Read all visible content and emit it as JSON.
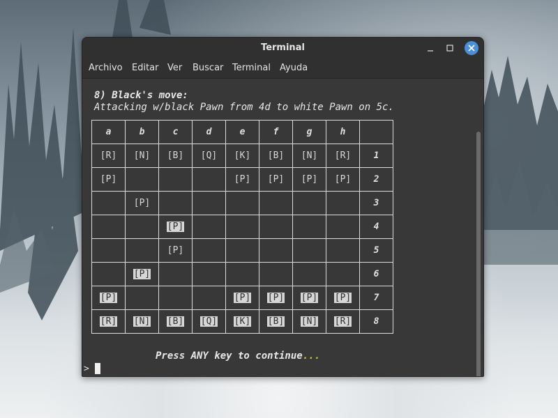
{
  "window": {
    "title": "Terminal"
  },
  "menu": [
    "Archivo",
    "Editar",
    "Ver",
    "Buscar",
    "Terminal",
    "Ayuda"
  ],
  "terminal": {
    "move_line": "8) Black's move:",
    "detail_line": "Attacking w/black Pawn from 4d to white Pawn on 5c.",
    "columns": [
      "a",
      "b",
      "c",
      "d",
      "e",
      "f",
      "g",
      "h",
      ""
    ],
    "rows": [
      {
        "cells": [
          "[R]",
          "[N]",
          "[B]",
          "[Q]",
          "[K]",
          "[B]",
          "[N]",
          "[R]"
        ],
        "hi": [
          0,
          0,
          0,
          0,
          0,
          0,
          0,
          0
        ],
        "num": "1"
      },
      {
        "cells": [
          "[P]",
          "",
          "",
          "",
          "[P]",
          "[P]",
          "[P]",
          "[P]"
        ],
        "hi": [
          0,
          0,
          0,
          0,
          0,
          0,
          0,
          0
        ],
        "num": "2"
      },
      {
        "cells": [
          "",
          "[P]",
          "",
          "",
          "",
          "",
          "",
          ""
        ],
        "hi": [
          0,
          0,
          0,
          0,
          0,
          0,
          0,
          0
        ],
        "num": "3"
      },
      {
        "cells": [
          "",
          "",
          "[P]",
          "",
          "",
          "",
          "",
          ""
        ],
        "hi": [
          0,
          0,
          1,
          0,
          0,
          0,
          0,
          0
        ],
        "num": "4"
      },
      {
        "cells": [
          "",
          "",
          "[P]",
          "",
          "",
          "",
          "",
          ""
        ],
        "hi": [
          0,
          0,
          0,
          0,
          0,
          0,
          0,
          0
        ],
        "num": "5"
      },
      {
        "cells": [
          "",
          "[P]",
          "",
          "",
          "",
          "",
          "",
          ""
        ],
        "hi": [
          0,
          1,
          0,
          0,
          0,
          0,
          0,
          0
        ],
        "num": "6"
      },
      {
        "cells": [
          "[P]",
          "",
          "",
          "",
          "[P]",
          "[P]",
          "[P]",
          "[P]"
        ],
        "hi": [
          1,
          0,
          0,
          0,
          1,
          1,
          1,
          1
        ],
        "num": "7"
      },
      {
        "cells": [
          "[R]",
          "[N]",
          "[B]",
          "[Q]",
          "[K]",
          "[B]",
          "[N]",
          "[R]"
        ],
        "hi": [
          1,
          1,
          1,
          1,
          1,
          1,
          1,
          1
        ],
        "num": "8"
      }
    ],
    "press_text": "Press ANY key to continue",
    "press_dots": "...",
    "prompt": ">"
  },
  "colors": {
    "terminal_bg": "#383838",
    "close_button": "#4a90d9",
    "dots_accent": "#c9c23a"
  },
  "icons": {
    "minimize": "minimize-icon",
    "maximize": "maximize-icon",
    "close": "close-icon"
  }
}
